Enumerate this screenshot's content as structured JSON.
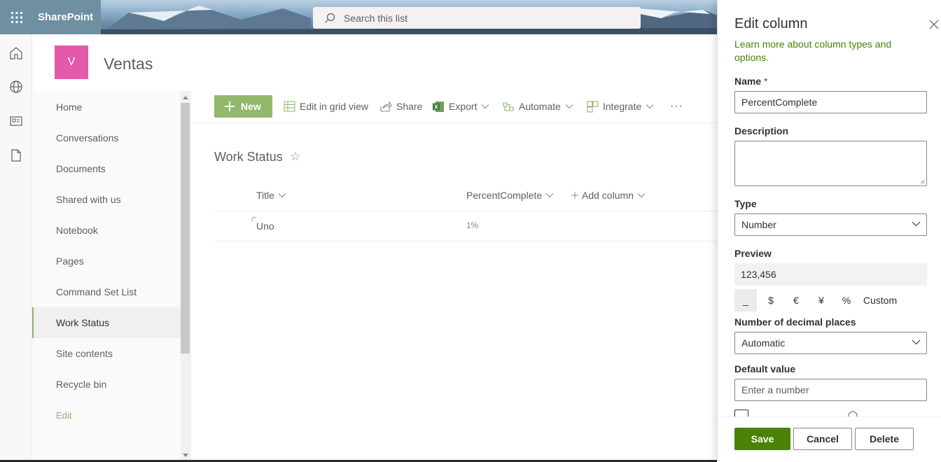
{
  "suite": {
    "brand": "SharePoint",
    "search_placeholder": "Search this list"
  },
  "site": {
    "logo_letter": "V",
    "title": "Ventas"
  },
  "nav": {
    "items": [
      {
        "label": "Home"
      },
      {
        "label": "Conversations"
      },
      {
        "label": "Documents"
      },
      {
        "label": "Shared with us"
      },
      {
        "label": "Notebook"
      },
      {
        "label": "Pages"
      },
      {
        "label": "Command Set List"
      },
      {
        "label": "Work Status"
      },
      {
        "label": "Site contents"
      },
      {
        "label": "Recycle bin"
      }
    ],
    "edit_label": "Edit",
    "active": "Work Status"
  },
  "commandbar": {
    "new_label": "New",
    "grid_label": "Edit in grid view",
    "share_label": "Share",
    "export_label": "Export",
    "automate_label": "Automate",
    "integrate_label": "Integrate",
    "more_label": "···"
  },
  "list": {
    "title": "Work Status",
    "columns": {
      "title": "Title",
      "percent": "PercentComplete",
      "add": "Add column"
    },
    "rows": [
      {
        "title": "Uno",
        "percent": "1%"
      }
    ]
  },
  "panel": {
    "heading": "Edit column",
    "learn_more": "Learn more about column types and options.",
    "name_label": "Name",
    "required_marker": " *",
    "name_value": "PercentComplete",
    "description_label": "Description",
    "description_value": "",
    "type_label": "Type",
    "type_value": "Number",
    "preview_label": "Preview",
    "preview_value": "123,456",
    "formats": [
      "_",
      "$",
      "€",
      "¥",
      "%",
      "Custom"
    ],
    "selected_format": "_",
    "decimal_label": "Number of decimal places",
    "decimal_value": "Automatic",
    "default_label": "Default value",
    "default_placeholder": "Enter a number",
    "save_label": "Save",
    "cancel_label": "Cancel",
    "delete_label": "Delete"
  },
  "colors": {
    "suite_blue": "#6f8fa3",
    "accent_green": "#92b86b",
    "link_green": "#498205",
    "save_green": "#498205",
    "logo_pink": "#e25aa8"
  }
}
